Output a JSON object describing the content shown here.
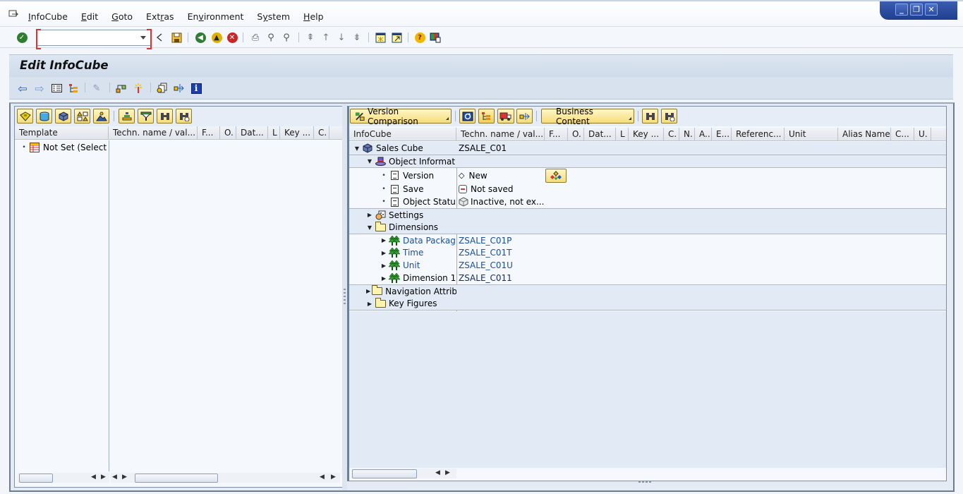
{
  "menubar": {
    "items": [
      "InfoCube",
      "Edit",
      "Goto",
      "Extras",
      "Environment",
      "System",
      "Help"
    ],
    "underline": [
      "I",
      "E",
      "G",
      "r",
      "v",
      "y",
      "H"
    ]
  },
  "window_controls": {
    "minimize": "_",
    "restore": "❐",
    "close": "✕"
  },
  "system_toolbar": {
    "command_field_value": "",
    "icons": [
      "enter-icon",
      "back-triangle-icon",
      "save-icon",
      "back-icon",
      "exit-icon",
      "cancel-icon",
      "print-icon",
      "find-icon",
      "find-next-icon",
      "first-page-icon",
      "previous-page-icon",
      "next-page-icon",
      "last-page-icon",
      "create-session-icon",
      "shortcut-icon",
      "help-icon",
      "customize-layout-icon"
    ]
  },
  "title": "Edit InfoCube",
  "app_toolbar": {
    "icons": [
      "previous-object-icon",
      "next-object-icon",
      "object-directory-icon",
      "tree-icon",
      "edit-icon",
      "check-icon",
      "activate-icon",
      "copy-icon",
      "transport-icon",
      "info-icon"
    ]
  },
  "left_pane": {
    "toolbar_icons": [
      "infoprovider-icon",
      "datastore-icon",
      "infocube-icon",
      "infoset-icon",
      "infoobject-catalog-icon",
      "expand-icon",
      "filter-icon",
      "find-icon",
      "find-next-icon"
    ],
    "columns": [
      "Template",
      "Techn. name / val...",
      "F...",
      "O.",
      "Dat...",
      "L",
      "Key ...",
      "C."
    ],
    "rows": [
      {
        "label": "Not Set (Select",
        "value": ""
      }
    ]
  },
  "right_pane": {
    "toolbar": {
      "version_comparison": "Version Comparison",
      "business_content": "Business Content",
      "icons": [
        "refresh-icon",
        "hierarchy-icon",
        "transport-truck-icon",
        "export-icon",
        "find-icon",
        "find-next-icon"
      ]
    },
    "columns": [
      "InfoCube",
      "Techn. name / val...",
      "F...",
      "O.",
      "Dat...",
      "L",
      "Key ...",
      "C.",
      "N.",
      "A..",
      "E...",
      "Referenc...",
      "Unit",
      "Alias Name",
      "C...",
      "U."
    ],
    "tree": {
      "root": {
        "label": "Sales Cube",
        "value": "ZSALE_C01"
      },
      "object_info": {
        "label": "Object Informat",
        "children": [
          {
            "label": "Version",
            "value": "New"
          },
          {
            "label": "Save",
            "value": "Not saved"
          },
          {
            "label": "Object Statu",
            "value": "Inactive, not ex..."
          }
        ]
      },
      "settings": {
        "label": "Settings"
      },
      "dimensions": {
        "label": "Dimensions",
        "children": [
          {
            "label": "Data Packag",
            "value": "ZSALE_C01P",
            "link": true
          },
          {
            "label": "Time",
            "value": "ZSALE_C01T",
            "link": true
          },
          {
            "label": "Unit",
            "value": "ZSALE_C01U",
            "link": true
          },
          {
            "label": "Dimension 1",
            "value": "ZSALE_C011",
            "link": false
          }
        ]
      },
      "navigation_attributes": {
        "label": "Navigation Attrib"
      },
      "key_figures": {
        "label": "Key Figures"
      }
    }
  },
  "colors": {
    "link": "#1a4f9c",
    "button_yellow": "#f6dd7a",
    "band": "#e1eaf5",
    "title_bg": "#d8e2ef"
  }
}
